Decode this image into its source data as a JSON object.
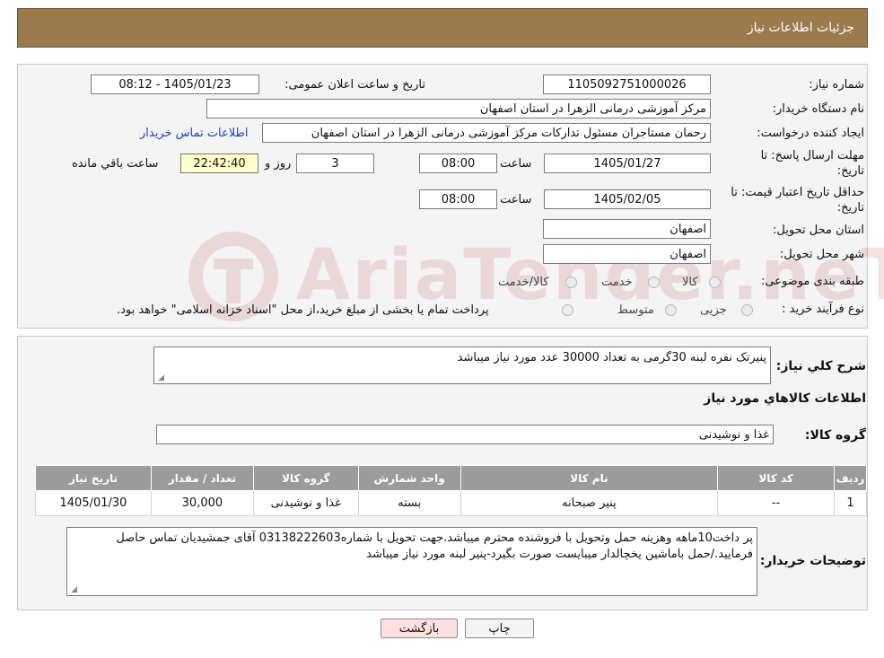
{
  "header": {
    "title": "جزئیات اطلاعات نیاز"
  },
  "watermark": {
    "text": "AriaTender.neT"
  },
  "form": {
    "need_number_label": "شماره نیاز:",
    "need_number": "1105092751000026",
    "announce_label": "تاریخ و ساعت اعلان عمومی:",
    "announce_value": "1405/01/23 - 08:12",
    "buyer_org_label": "نام دستگاه خریدار:",
    "buyer_org": "مرکز آموزشی درمانی الزهرا در استان اصفهان",
    "creator_label": "ایجاد کننده درخواست:",
    "creator": "رحمان مستاجران مسئول تدارکات مرکز آموزشی درمانی الزهرا در استان اصفهان",
    "contact_link": "اطلاعات تماس خریدار",
    "reply_deadline_label_1": "مهلت ارسال پاسخ: تا",
    "reply_deadline_label_2": "تاریخ:",
    "reply_date": "1405/01/27",
    "time_label": "ساعت",
    "reply_time": "08:00",
    "days_value": "3",
    "days_label": "روز و",
    "remaining_time": "22:42:40",
    "remaining_label": "ساعت باقي مانده",
    "price_valid_label_1": "حداقل تاریخ اعتبار قیمت: تا",
    "price_valid_label_2": "تاریخ:",
    "price_valid_date": "1405/02/05",
    "price_valid_time": "08:00",
    "province_label": "استان محل تحویل:",
    "province": "اصفهان",
    "city_label": "شهر محل تحویل:",
    "city": "اصفهان",
    "category_label": "طبقه بندی موضوعی:",
    "category_options": [
      "کالا",
      "خدمت",
      "کالا/خدمت"
    ],
    "process_label": "نوع فرآیند خرید :",
    "process_options": [
      "جزیی",
      "متوسط"
    ],
    "process_note": "پرداخت تمام یا بخشی از مبلغ خرید،از محل \"اسناد خزانه اسلامی\" خواهد بود."
  },
  "details": {
    "summary_label": "شرح کلي نياز:",
    "summary": "پنیرتک نفره لبنه 30گرمی به تعداد 30000 عدد مورد نیاز میباشد",
    "goods_info_title": "اطلاعات کالاهاي مورد نياز",
    "goods_group_label": "گروه کالا:",
    "goods_group": "غذا و نوشیدنی",
    "table": {
      "headers": [
        "ردیف",
        "کد کالا",
        "نام کالا",
        "واحد شمارش",
        "گروه کالا",
        "تعداد / مقدار",
        "تاریخ نیاز"
      ],
      "rows": [
        [
          "1",
          "--",
          "پنیر صبحانه",
          "بسته",
          "غذا و نوشیدنی",
          "30,000",
          "1405/01/30"
        ]
      ]
    },
    "buyer_notes_label": "توضیحات خریدار:",
    "buyer_notes": "پر داخت10ماهه وهزینه حمل وتحویل با فروشنده محترم میباشد.جهت تحویل با شماره03138222603 آقای جمشیدیان تماس حاصل فرمایید./حمل باماشین یخچالدار میبایست صورت بگیرد-پنیر لبنه مورد نیاز میباشد"
  },
  "buttons": {
    "print": "چاپ",
    "back": "بازگشت"
  },
  "colors": {
    "header_bg": "#9b7b4e",
    "table_header_bg": "#9b9b9b",
    "back_button_bg": "#fde1e1",
    "link": "#1a3fbf"
  }
}
